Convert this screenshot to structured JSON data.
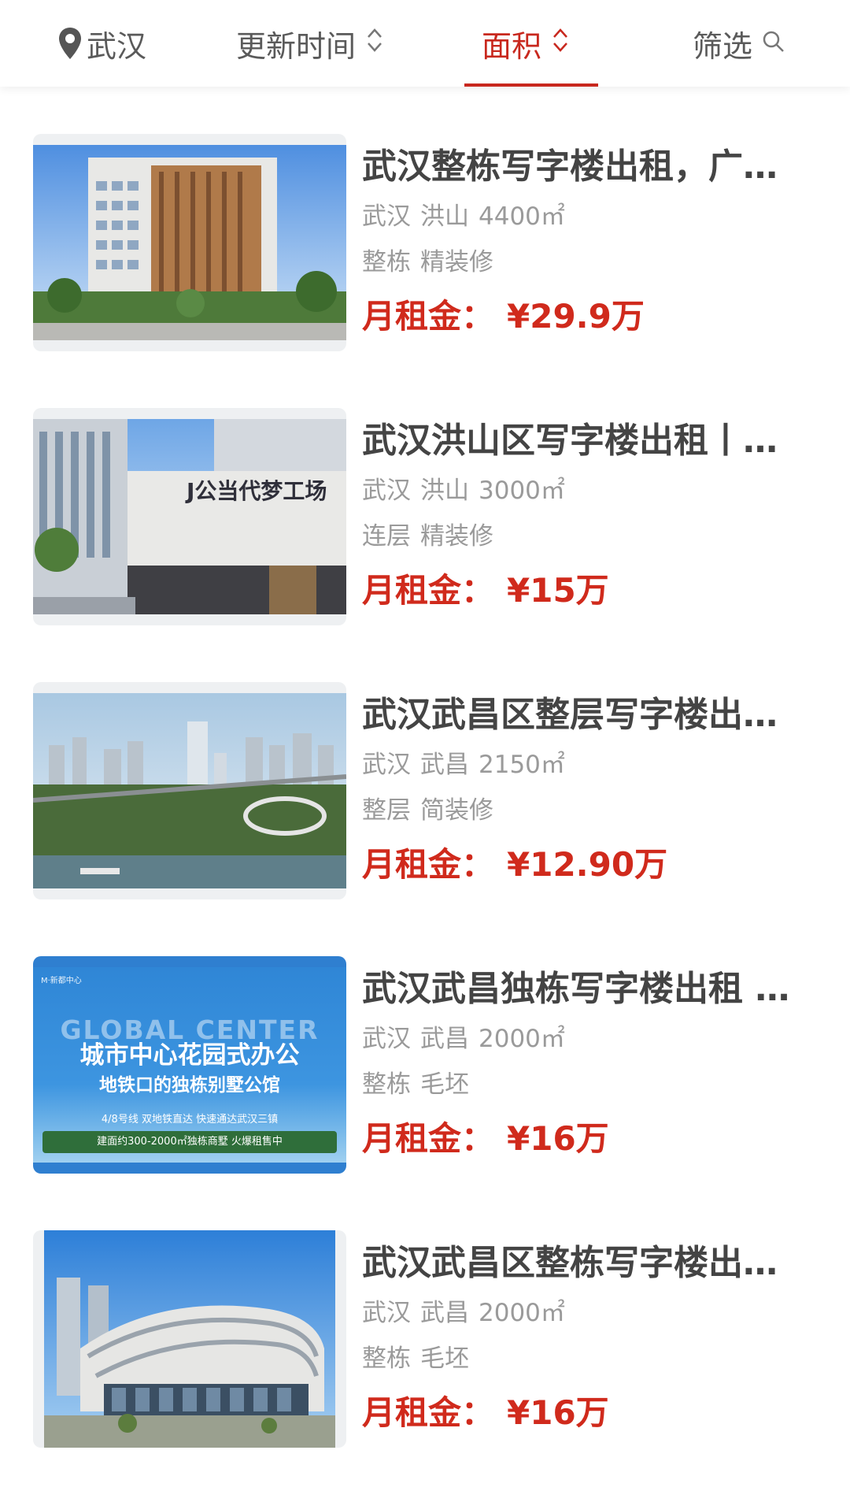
{
  "filter_bar": {
    "location": "武汉",
    "update_time": "更新时间",
    "area": "面积",
    "filter": "筛选",
    "sort_icon": "sort-updown-icon",
    "search_icon": "search-icon",
    "location_icon": "map-pin-icon",
    "active_color": "#c8281e"
  },
  "listings": [
    {
      "title": "武汉整栋写字楼出租，广…",
      "city": "武汉",
      "district": "洪山",
      "area": "4400㎡",
      "type": "整栋",
      "decoration": "精装修",
      "price_label": "月租金：",
      "price": "¥29.9万"
    },
    {
      "title": "武汉洪山区写字楼出租丨…",
      "city": "武汉",
      "district": "洪山",
      "area": "3000㎡",
      "type": "连层",
      "decoration": "精装修",
      "price_label": "月租金：",
      "price": "¥15万"
    },
    {
      "title": "武汉武昌区整层写字楼出…",
      "city": "武汉",
      "district": "武昌",
      "area": "2150㎡",
      "type": "整层",
      "decoration": "简装修",
      "price_label": "月租金：",
      "price": "¥12.90万"
    },
    {
      "title": "武汉武昌独栋写字楼出租 …",
      "city": "武汉",
      "district": "武昌",
      "area": "2000㎡",
      "type": "整栋",
      "decoration": "毛坯",
      "price_label": "月租金：",
      "price": "¥16万",
      "image_text": {
        "logo": "M·新都中心",
        "english": "GLOBAL CENTER",
        "headline": "城市中心花园式办公",
        "subheadline": "地铁口的独栋别墅公馆",
        "line1": "4/8号线 双地铁直达  快速通达武汉三镇",
        "line2": "建面约300-2000㎡独栋商墅 火爆租售中"
      }
    },
    {
      "title": "武汉武昌区整栋写字楼出…",
      "city": "武汉",
      "district": "武昌",
      "area": "2000㎡",
      "type": "整栋",
      "decoration": "毛坯",
      "price_label": "月租金：",
      "price": "¥16万"
    }
  ]
}
